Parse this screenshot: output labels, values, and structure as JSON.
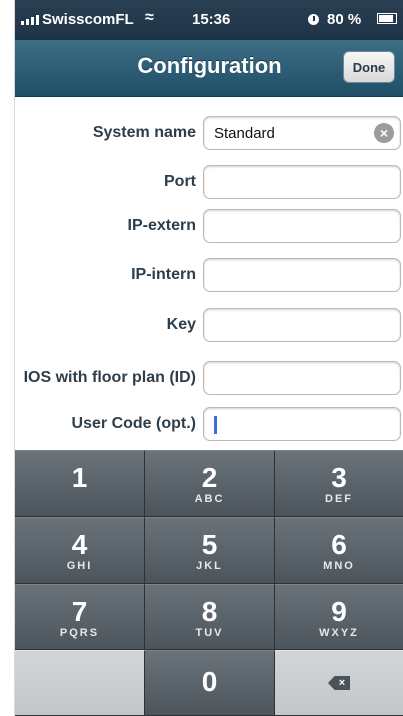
{
  "status_bar": {
    "carrier": "SwisscomFL",
    "time": "15:36",
    "battery": "80 %",
    "icons": [
      "signal-bars-icon",
      "wifi-icon",
      "clock-icon",
      "battery-icon"
    ]
  },
  "nav_bar": {
    "title": "Configuration",
    "done_label": "Done"
  },
  "form": {
    "fields": [
      {
        "label": "System name",
        "value": "Standard"
      },
      {
        "label": "Port",
        "value": ""
      },
      {
        "label": "IP-extern",
        "value": ""
      },
      {
        "label": "IP-intern",
        "value": ""
      },
      {
        "label": "Key",
        "value": ""
      },
      {
        "label": "IOS with floor plan (ID)",
        "value": ""
      },
      {
        "label": "User Code (opt.)",
        "value": ""
      }
    ]
  },
  "keypad": {
    "keys": [
      {
        "num": "1",
        "letters": ""
      },
      {
        "num": "2",
        "letters": "ABC"
      },
      {
        "num": "3",
        "letters": "DEF"
      },
      {
        "num": "4",
        "letters": "GHI"
      },
      {
        "num": "5",
        "letters": "JKL"
      },
      {
        "num": "6",
        "letters": "MNO"
      },
      {
        "num": "7",
        "letters": "PQRS"
      },
      {
        "num": "8",
        "letters": "TUV"
      },
      {
        "num": "9",
        "letters": "WXYZ"
      },
      {
        "num": "0",
        "letters": ""
      }
    ]
  },
  "colors": {
    "nav_bar": "#2a5a72",
    "status_bar": "#1e3446",
    "label_text": "#2f3e4b",
    "keypad_dark": "#555d64",
    "keypad_light": "#c9cccf",
    "caret": "#3a6fd8"
  }
}
